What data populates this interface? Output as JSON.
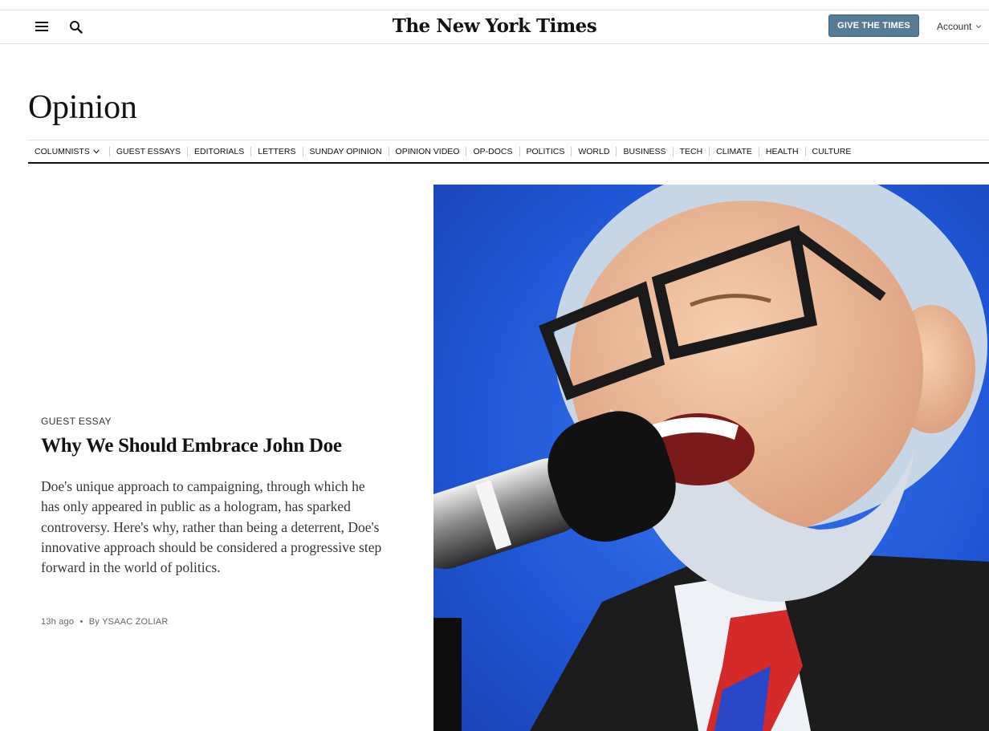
{
  "header": {
    "logo": "The New York Times",
    "give_button": "GIVE THE TIMES",
    "account_label": "Account"
  },
  "section": {
    "title": "Opinion"
  },
  "nav": {
    "items": [
      {
        "label": "COLUMNISTS",
        "has_dropdown": true
      },
      {
        "label": "GUEST ESSAYS"
      },
      {
        "label": "EDITORIALS"
      },
      {
        "label": "LETTERS"
      },
      {
        "label": "SUNDAY OPINION"
      },
      {
        "label": "OPINION VIDEO"
      },
      {
        "label": "OP-DOCS"
      },
      {
        "label": "POLITICS"
      },
      {
        "label": "WORLD"
      },
      {
        "label": "BUSINESS"
      },
      {
        "label": "TECH"
      },
      {
        "label": "CLIMATE"
      },
      {
        "label": "HEALTH"
      },
      {
        "label": "CULTURE"
      }
    ]
  },
  "article": {
    "kicker": "GUEST ESSAY",
    "headline": "Why We Should Embrace John Doe",
    "summary": "Doe's unique approach to campaigning, through which he has only appeared in public as a hologram, has sparked controversy. Here's why, rather than being a deterrent, Doe's innovative approach should be considered a progressive step forward in the world of politics.",
    "time": "13h ago",
    "byline_sep": "•",
    "byline_prefix": "By",
    "author": "YSAAC ZOLIAR"
  },
  "icons": {
    "menu": "hamburger-menu-icon",
    "search": "search-icon",
    "dropdown": "chevron-down-icon"
  },
  "colors": {
    "give_button_bg": "#567b95",
    "hero_background": "#1f56d6",
    "rule": "#121212"
  }
}
